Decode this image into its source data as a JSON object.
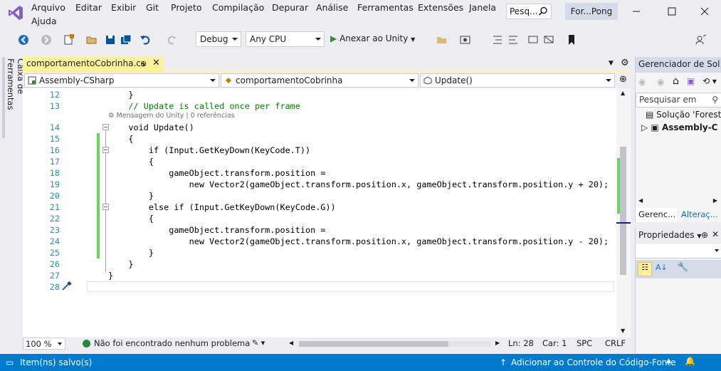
{
  "menu": {
    "items": [
      "Arquivo",
      "Editar",
      "Exibir",
      "Git",
      "Projeto",
      "Compilação",
      "Depurar",
      "Análise",
      "Ferramentas",
      "Extensões",
      "Janela",
      "Ajuda"
    ],
    "search_placeholder": "Pesq...",
    "solution_title": "For...Pong"
  },
  "toolbar": {
    "config": "Debug",
    "platform": "Any CPU",
    "attach": "Anexar ao Unity"
  },
  "toolbox": {
    "label": "Caixa de Ferramentas"
  },
  "editor": {
    "tab_title": "comportamentoCobrinha.cs",
    "tab_pin": "⊕",
    "tab_close": "✕",
    "nav": {
      "project": "Assembly-CSharp",
      "class": "comportamentoCobrinha",
      "member": "Update()"
    },
    "codelens": "Mensagem do Unity | 0 referências",
    "lines": [
      {
        "n": "12",
        "code": "    }"
      },
      {
        "n": "13",
        "code": "    // Update is called once per frame"
      },
      {
        "n": "14",
        "code": "    void Update()"
      },
      {
        "n": "15",
        "code": "    {"
      },
      {
        "n": "16",
        "code": "        if (Input.GetKeyDown(KeyCode.T))"
      },
      {
        "n": "17",
        "code": "        {"
      },
      {
        "n": "18",
        "code": "            gameObject.transform.position ="
      },
      {
        "n": "19",
        "code": "                new Vector2(gameObject.transform.position.x, gameObject.transform.position.y + 20);"
      },
      {
        "n": "20",
        "code": "        }"
      },
      {
        "n": "21",
        "code": "        else if (Input.GetKeyDown(KeyCode.G))"
      },
      {
        "n": "22",
        "code": "        {"
      },
      {
        "n": "23",
        "code": "            gameObject.transform.position ="
      },
      {
        "n": "24",
        "code": "                new Vector2(gameObject.transform.position.x, gameObject.transform.position.y - 20);"
      },
      {
        "n": "25",
        "code": "        }"
      },
      {
        "n": "26",
        "code": "    }"
      },
      {
        "n": "27",
        "code": "}"
      },
      {
        "n": "28",
        "code": ""
      }
    ]
  },
  "editor_status": {
    "zoom": "100 %",
    "problems": "Não foi encontrado nenhum problema",
    "line": "Ln: 28",
    "col": "Car: 1",
    "whitespace": "SPC",
    "eol": "CRLF"
  },
  "solution_explorer": {
    "title": "Gerenciador de Sol...",
    "search_placeholder": "Pesquisar em",
    "items": [
      "Solução 'Forest",
      "Assembly-C"
    ],
    "tabs": [
      "Gerenc...",
      "Alteraç..."
    ]
  },
  "properties": {
    "title": "Propriedades"
  },
  "statusbar": {
    "left": "Item(ns) salvo(s)",
    "right": "Adicionar ao Controle do Código-Fonte"
  },
  "colors": {
    "accent": "#007acc",
    "tab_active": "#fff29d",
    "change_bar": "#6fd164"
  }
}
